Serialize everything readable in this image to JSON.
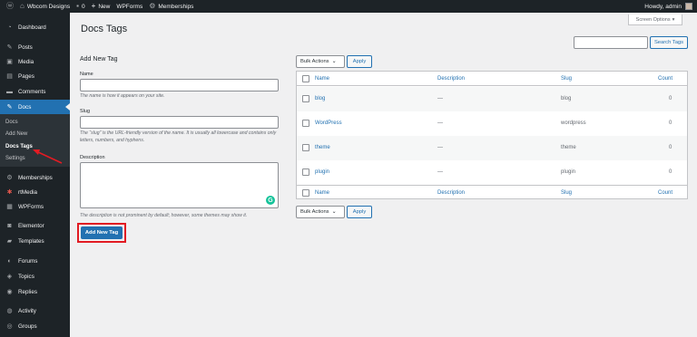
{
  "adminbar": {
    "site_name": "Wbcom Designs",
    "comments_count": "0",
    "new_label": "New",
    "wpforms_label": "WPForms",
    "memberships_label": "Memberships",
    "howdy": "Howdy, admin"
  },
  "sidebar": {
    "dashboard": "Dashboard",
    "posts": "Posts",
    "media": "Media",
    "pages": "Pages",
    "comments": "Comments",
    "docs": "Docs",
    "submenu": [
      "Docs",
      "Add New",
      "Docs Tags",
      "Settings"
    ],
    "memberships": "Memberships",
    "rtmedia": "rtMedia",
    "wpforms": "WPForms",
    "elementor": "Elementor",
    "templates": "Templates",
    "forums": "Forums",
    "topics": "Topics",
    "replies": "Replies",
    "activity": "Activity",
    "groups": "Groups"
  },
  "screen_options": "Screen Options",
  "page_title": "Docs Tags",
  "search": {
    "button": "Search Tags",
    "value": ""
  },
  "form": {
    "title": "Add New Tag",
    "name_label": "Name",
    "name_help": "The name is how it appears on your site.",
    "slug_label": "Slug",
    "slug_help": "The “slug” is the URL-friendly version of the name. It is usually all lowercase and contains only letters, numbers, and hyphens.",
    "desc_label": "Description",
    "desc_help": "The description is not prominent by default; however, some themes may show it.",
    "submit": "Add New Tag"
  },
  "table": {
    "bulk_label": "Bulk Actions",
    "apply_label": "Apply",
    "columns": {
      "name": "Name",
      "description": "Description",
      "slug": "Slug",
      "count": "Count"
    },
    "rows": [
      {
        "name": "blog",
        "description": "—",
        "slug": "blog",
        "count": "0"
      },
      {
        "name": "WordPress",
        "description": "—",
        "slug": "wordpress",
        "count": "0"
      },
      {
        "name": "theme",
        "description": "—",
        "slug": "theme",
        "count": "0"
      },
      {
        "name": "plugin",
        "description": "—",
        "slug": "plugin",
        "count": "0"
      }
    ]
  },
  "colors": {
    "adminbar": "#1d2327",
    "accent": "#2271b1",
    "annotation": "#e21b23"
  }
}
